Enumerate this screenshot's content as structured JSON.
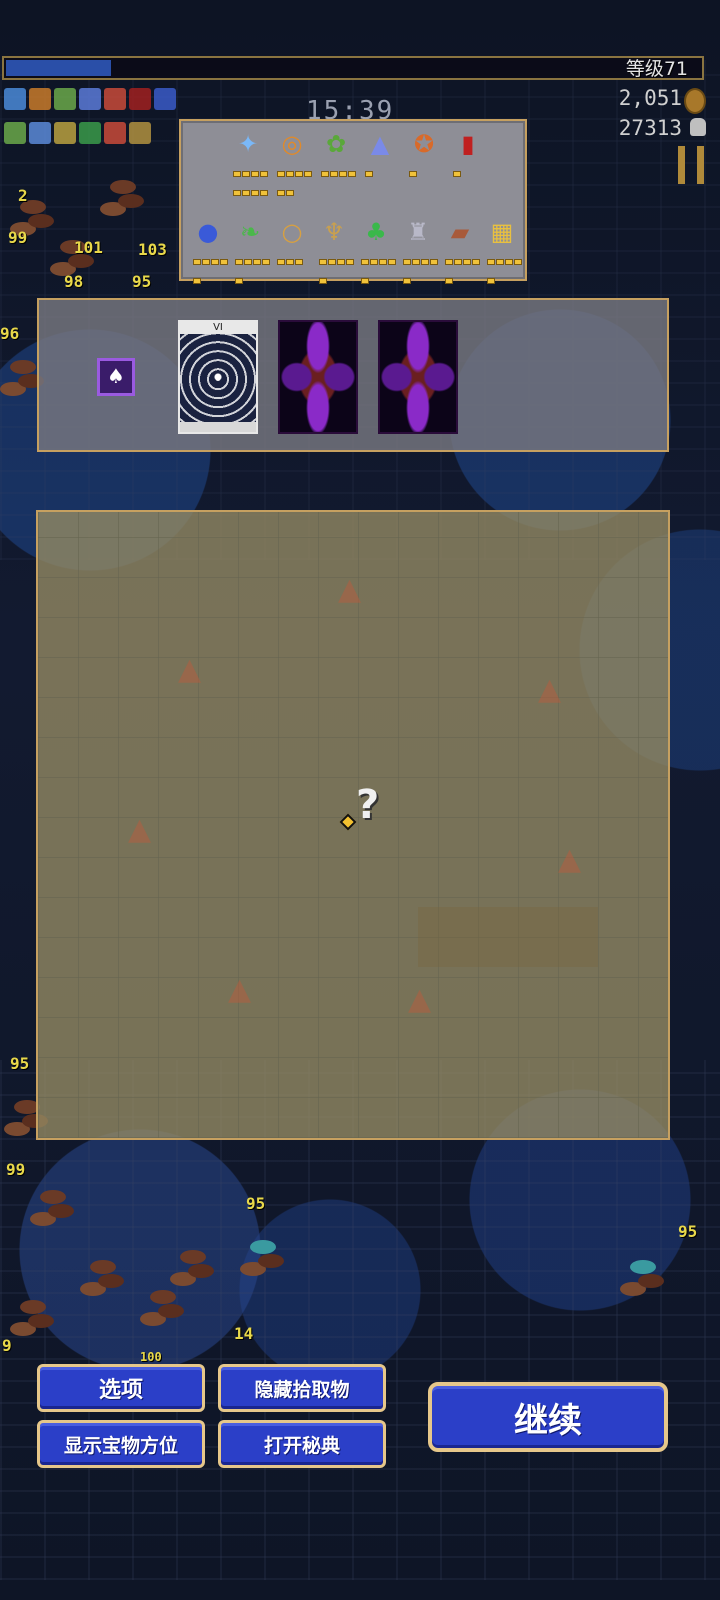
{
  "hud": {
    "level_label": "等级71",
    "xp_fraction": 0.15,
    "timer": "15:39",
    "gold": "2,051",
    "kills": "27313",
    "mini_icon_colors": [
      "#4a8ad8",
      "#c87a2a",
      "#6aa84a",
      "#5a7ad8",
      "#c84a3a",
      "#a02020",
      "#3a5ac8",
      "#6aa84a",
      "#5a8ad8",
      "#b8a040",
      "#3a9a4a",
      "#c84a3a",
      "#b09040"
    ]
  },
  "scene": {
    "damage_numbers": [
      "101",
      "103",
      "98",
      "95",
      "2",
      "99",
      "96",
      "99",
      "95",
      "95",
      "95",
      "100",
      "9",
      "14"
    ]
  },
  "inventory": {
    "weapons": [
      {
        "name": "lightning-ring-icon",
        "glyph": "✦",
        "color": "#7ab8f8",
        "pips": 8
      },
      {
        "name": "whip-icon",
        "glyph": "◎",
        "color": "#e08a2a",
        "pips": 6
      },
      {
        "name": "palm-icon",
        "glyph": "✿",
        "color": "#5aa83a",
        "pips": 4
      },
      {
        "name": "flask-icon",
        "glyph": "▲",
        "color": "#7a8ae8",
        "pips": 1
      },
      {
        "name": "cross-ring-icon",
        "glyph": "✪",
        "color": "#d86a2a",
        "pips": 1
      },
      {
        "name": "book-icon",
        "glyph": "▮",
        "color": "#c02020",
        "pips": 1
      }
    ],
    "passives": [
      {
        "name": "blue-orb-icon",
        "glyph": "●",
        "color": "#3a5ad8",
        "pips": 5
      },
      {
        "name": "feather-icon",
        "glyph": "❧",
        "color": "#4ab84a",
        "pips": 5
      },
      {
        "name": "ring-icon",
        "glyph": "○",
        "color": "#d8a040",
        "pips": 3
      },
      {
        "name": "candelabra-icon",
        "glyph": "♆",
        "color": "#c8a050",
        "pips": 5
      },
      {
        "name": "clover-icon",
        "glyph": "♣",
        "color": "#3ab84a",
        "pips": 5
      },
      {
        "name": "armor-icon",
        "glyph": "♜",
        "color": "#b8b8c8",
        "pips": 5
      },
      {
        "name": "bracer-icon",
        "glyph": "▰",
        "color": "#a85a3a",
        "pips": 5
      },
      {
        "name": "tome-icon",
        "glyph": "▦",
        "color": "#e8c040",
        "pips": 5
      }
    ]
  },
  "arcana": {
    "icon_glyph": "♠",
    "card_numeral": "VI",
    "cards": [
      "revealed",
      "back",
      "back"
    ]
  },
  "map": {
    "unknown_marker": "?"
  },
  "buttons": {
    "options": "选项",
    "hide_pickups": "隐藏拾取物",
    "show_treasure": "显示宝物方位",
    "open_grimoire": "打开秘典",
    "continue": "继续"
  }
}
